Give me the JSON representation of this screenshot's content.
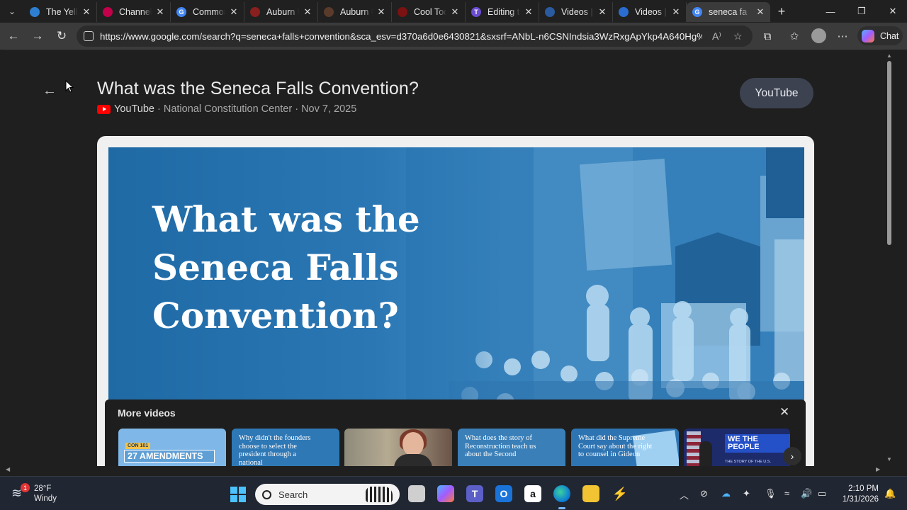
{
  "tabs": [
    {
      "title": "The Yellow",
      "fav_color": "#2f7fd0",
      "fav_char": ""
    },
    {
      "title": "Channel c",
      "fav_color": "#c3004a",
      "fav_char": ""
    },
    {
      "title": "Common",
      "fav_color": "#4285f4",
      "fav_char": "G"
    },
    {
      "title": "Auburn U",
      "fav_color": "#8a1f1f",
      "fav_char": ""
    },
    {
      "title": "Auburn U",
      "fav_color": "#5a3a2a",
      "fav_char": ""
    },
    {
      "title": "Cool Tool",
      "fav_color": "#7a1212",
      "fav_char": ""
    },
    {
      "title": "Editing tit",
      "fav_color": "#6a4ccf",
      "fav_char": "T"
    },
    {
      "title": "Videos | U",
      "fav_color": "#2a5aa0",
      "fav_char": ""
    },
    {
      "title": "Videos | U",
      "fav_color": "#2a6cd0",
      "fav_char": ""
    },
    {
      "title": "seneca fa",
      "fav_color": "#4285f4",
      "fav_char": "G"
    }
  ],
  "address_bar": {
    "url": "https://www.google.com/search?q=seneca+falls+convention&sca_esv=d370a6d0e6430821&sxsrf=ANbL-n6CSNIndsia3WzRxgApYkp4A640Hg%3..."
  },
  "chat_label": "Chat",
  "video": {
    "title": "What was the Seneca Falls Convention?",
    "source": "YouTube",
    "meta": "· National Constitution Center · Nov 7, 2025",
    "open_button": "YouTube",
    "thumbnail_text": "What was the Seneca Falls Convention?"
  },
  "more_videos": {
    "heading": "More videos",
    "items": [
      {
        "tag": "CON 101",
        "caption": "27 AMENDMENTS"
      },
      {
        "caption": "Why didn't the founders choose to select the president through a national"
      },
      {
        "caption": ""
      },
      {
        "caption": "What does the story of Reconstruction teach us about the Second"
      },
      {
        "caption": "What did the Supreme Court say about the right to counsel in Gideon"
      },
      {
        "caption": "WE THE PEOPLE",
        "sub": "THE STORY OF THE U.S."
      }
    ]
  },
  "taskbar": {
    "weather_temp": "28°F",
    "weather_desc": "Windy",
    "weather_badge": "1",
    "search_placeholder": "Search",
    "time": "2:10 PM",
    "date": "1/31/2026"
  }
}
